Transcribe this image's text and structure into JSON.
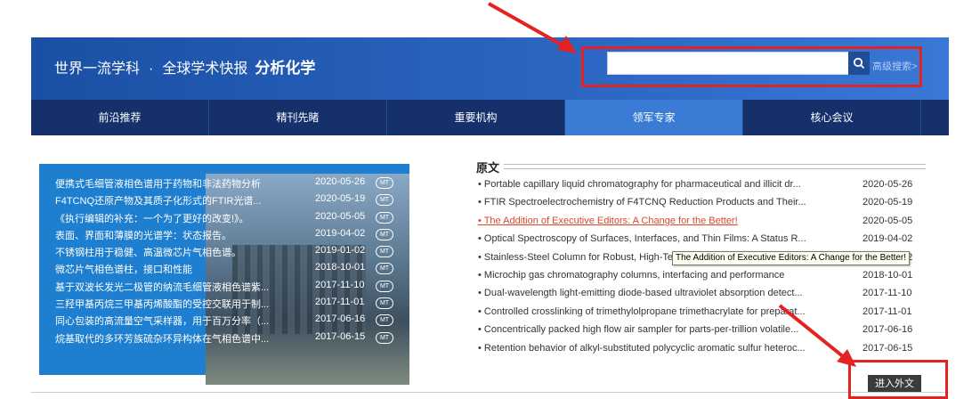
{
  "header": {
    "brand_main": "世界一流学科",
    "brand_dot": "·",
    "brand_sub": "全球学术快报",
    "subject": "分析化学",
    "search_value": "",
    "advanced_search": "高级搜索>"
  },
  "nav": {
    "items": [
      {
        "label": "前沿推荐",
        "active": false
      },
      {
        "label": "精刊先睹",
        "active": false
      },
      {
        "label": "重要机构",
        "active": false
      },
      {
        "label": "领军专家",
        "active": true
      },
      {
        "label": "核心会议",
        "active": false
      }
    ]
  },
  "left_list": {
    "items": [
      {
        "title": "便携式毛细管液相色谱用于药物和非法药物分析",
        "date": "2020-05-26",
        "badge": "MT"
      },
      {
        "title": "F4TCNQ还原产物及其质子化形式的FTIR光谱...",
        "date": "2020-05-19",
        "badge": "MT"
      },
      {
        "title": "《执行编辑的补充：一个为了更好的改变!》。",
        "date": "2020-05-05",
        "badge": "MT"
      },
      {
        "title": "表面、界面和薄膜的光谱学：状态报告。",
        "date": "2019-04-02",
        "badge": "MT"
      },
      {
        "title": "不锈钢柱用于稳健、高温微芯片气相色谱。",
        "date": "2019-01-02",
        "badge": "MT"
      },
      {
        "title": "微芯片气相色谱柱，接口和性能",
        "date": "2018-10-01",
        "badge": "MT"
      },
      {
        "title": "基于双波长发光二极管的纳流毛细管液相色谱紫...",
        "date": "2017-11-10",
        "badge": "MT"
      },
      {
        "title": "三羟甲基丙烷三甲基丙烯酸酯的受控交联用于制...",
        "date": "2017-11-01",
        "badge": "MT"
      },
      {
        "title": "同心包装的高流量空气采样器，用于百万分率（...",
        "date": "2017-06-16",
        "badge": "MT"
      },
      {
        "title": "烷基取代的多环芳族硫杂环异构体在气相色谱中...",
        "date": "2017-06-15",
        "badge": "MT"
      }
    ]
  },
  "original": {
    "heading": "原文",
    "items": [
      {
        "title": "• Portable capillary liquid chromatography for pharmaceutical and illicit dr...",
        "date": "2020-05-26",
        "link": false
      },
      {
        "title": "• FTIR Spectroelectrochemistry of F4TCNQ Reduction Products and Their...",
        "date": "2020-05-19",
        "link": false
      },
      {
        "title": "• The Addition of Executive Editors: A Change for the Better!",
        "date": "2020-05-05",
        "link": true
      },
      {
        "title": "• Optical Spectroscopy of Surfaces, Interfaces, and Thin Films: A Status R...",
        "date": "2019-04-02",
        "link": false
      },
      {
        "title": "• Stainless-Steel Column for Robust, High-Temperature Microchip Gas Ch...",
        "date": "2019-01-02",
        "link": false
      },
      {
        "title": "• Microchip gas chromatography columns, interfacing and performance",
        "date": "2018-10-01",
        "link": false
      },
      {
        "title": "• Dual-wavelength light-emitting diode-based ultraviolet absorption detect...",
        "date": "2017-11-10",
        "link": false
      },
      {
        "title": "• Controlled crosslinking of trimethylolpropane trimethacrylate for preparat...",
        "date": "2017-11-01",
        "link": false
      },
      {
        "title": "• Concentrically packed high flow air sampler for parts-per-trillion volatile...",
        "date": "2017-06-16",
        "link": false
      },
      {
        "title": "• Retention behavior of alkyl-substituted polycyclic aromatic sulfur heteroc...",
        "date": "2017-06-15",
        "link": false
      }
    ],
    "tooltip": "The Addition of Executive Editors: A Change for the Better!",
    "enter_button": "进入外文"
  },
  "colors": {
    "header_blue": "#2b64c1",
    "nav_dark": "#15306b",
    "nav_active": "#3a7bd5",
    "panel_blue": "#1e7ecf",
    "link_red": "#e0452a",
    "annotation_red": "#e32222"
  },
  "icons": {
    "search": "search-icon"
  }
}
